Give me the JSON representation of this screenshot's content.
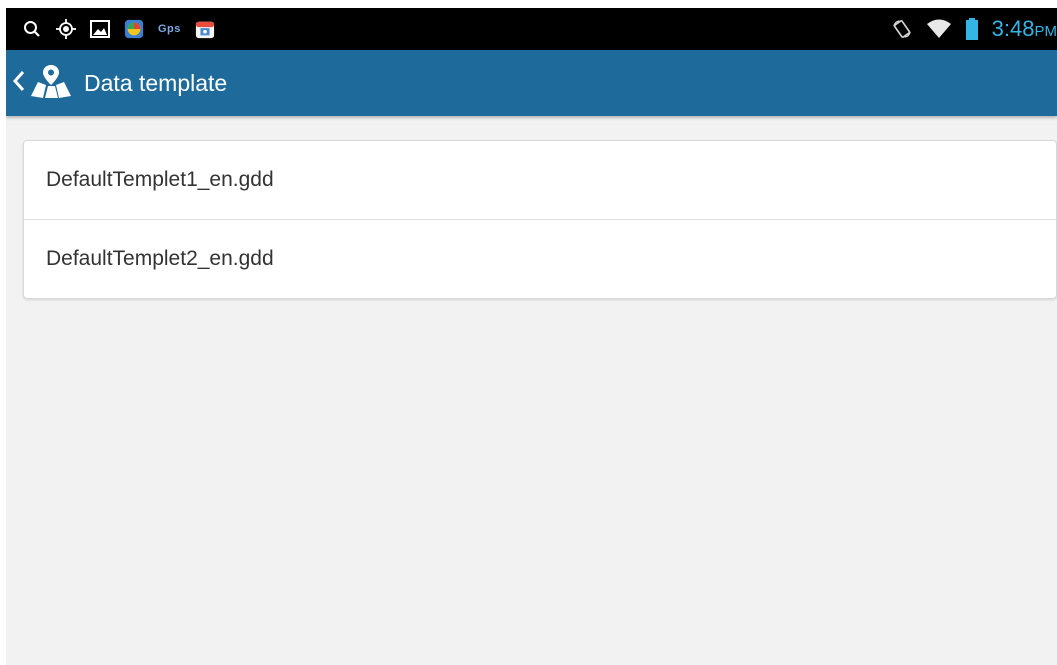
{
  "status_bar": {
    "left_icons": [
      "search-icon",
      "location-target-icon",
      "image-icon",
      "app-icon",
      "gps-icon",
      "store-icon"
    ],
    "gps_label": "Gps",
    "right_icons": [
      "rotation-icon",
      "wifi-icon",
      "battery-icon"
    ],
    "time": "3:48",
    "ampm": "PM",
    "clock_color": "#33b5e5"
  },
  "action_bar": {
    "title": "Data template",
    "background_color": "#1e6b9b",
    "icons": [
      "back-chevron-icon",
      "map-pin-app-icon"
    ]
  },
  "list": {
    "items": [
      {
        "label": "DefaultTemplet1_en.gdd"
      },
      {
        "label": "DefaultTemplet2_en.gdd"
      }
    ]
  },
  "colors": {
    "background": "#f2f2f2",
    "card": "#ffffff",
    "text": "#333333"
  }
}
